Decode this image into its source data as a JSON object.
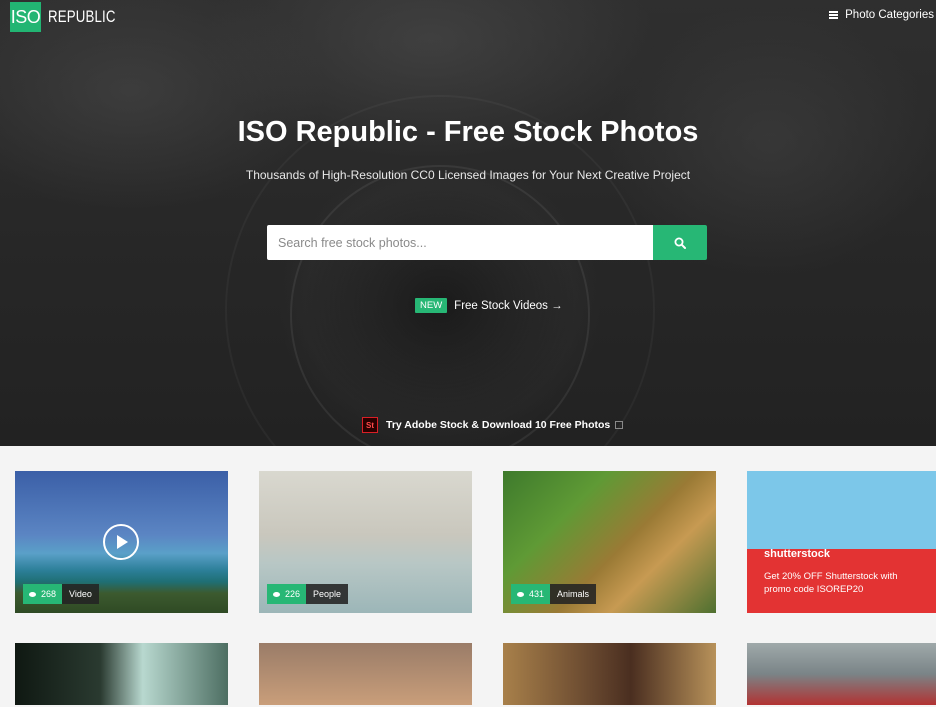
{
  "header": {
    "logo": {
      "iso": "ISO",
      "republic": "REPUBLIC"
    },
    "nav_categories": "Photo Categories"
  },
  "hero": {
    "title": "ISO Republic - Free Stock Photos",
    "subtitle": "Thousands of High-Resolution CC0 Licensed Images for Your Next Creative Project",
    "search": {
      "placeholder": "Search free stock photos..."
    },
    "new_badge": "NEW",
    "videos_link": "Free Stock Videos →",
    "adobe_logo": "St",
    "adobe_promo": "Try Adobe Stock & Download 10 Free Photos"
  },
  "cards": [
    {
      "count": "268",
      "label": "Video"
    },
    {
      "count": "226",
      "label": "People"
    },
    {
      "count": "431",
      "label": "Animals"
    }
  ],
  "shutterstock": {
    "brand": "shutterstock",
    "promo": "Get 20% OFF Shutterstock with promo code ISOREP20"
  },
  "colors": {
    "accent_green": "#27b775",
    "hero_bg": "#2a2a2a",
    "shutterstock_red": "#e33333",
    "adobe_red": "#da1f26"
  },
  "icons": {
    "menu": "hamburger-icon",
    "search": "search-icon",
    "play": "play-icon",
    "views": "eye-icon",
    "external": "external-link-icon"
  }
}
